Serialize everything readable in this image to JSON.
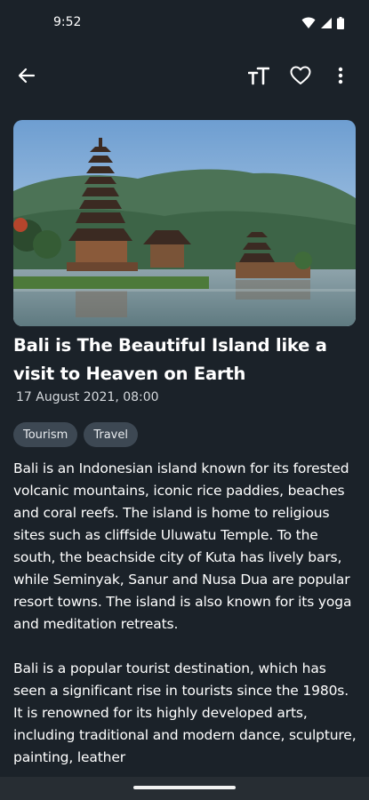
{
  "status_bar": {
    "time": "9:52",
    "icons": [
      "wifi-icon",
      "signal-icon",
      "battery-icon"
    ]
  },
  "app_bar": {
    "icons": [
      "back-arrow-icon",
      "text-size-icon",
      "heart-icon",
      "more-vert-icon"
    ]
  },
  "article": {
    "image": "Bali temple on lake with mountains",
    "title": "Bali is The Beautiful Island like a visit to Heaven on Earth",
    "date": "17 August 2021, 08:00",
    "tags": [
      "Tourism",
      "Travel"
    ],
    "paragraphs": [
      "Bali is an Indonesian island known for its forested volcanic mountains, iconic rice paddies, beaches and coral reefs. The island is home to religious sites such as cliffside Uluwatu Temple. To the south, the beachside city of Kuta has lively bars, while Seminyak, Sanur and Nusa Dua are popular resort towns. The island is also known for its yoga and meditation retreats.",
      "Bali is a popular tourist destination, which has seen a significant rise in tourists since the 1980s. It is renowned for its highly developed arts, including traditional and modern dance, sculpture, painting, leather"
    ]
  },
  "colors": {
    "background": "#1b2229",
    "tag_background": "#3d4853",
    "text": "#ffffff"
  }
}
